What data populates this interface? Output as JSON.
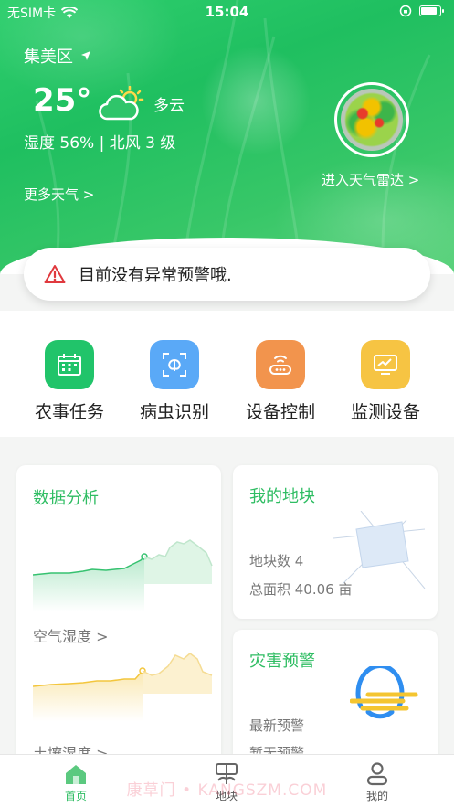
{
  "status_bar": {
    "carrier": "无SIM卡",
    "time": "15:04"
  },
  "weather": {
    "location": "集美区",
    "temperature": "25°",
    "condition": "多云",
    "humidity_wind": "湿度 56% | 北风 3 级",
    "more_link": "更多天气 >",
    "radar_link": "进入天气雷达 >"
  },
  "alert": {
    "message": "目前没有异常预警哦."
  },
  "quick_actions": [
    {
      "label": "农事任务",
      "icon": "calendar-icon",
      "color": "#21c46a"
    },
    {
      "label": "病虫识别",
      "icon": "bug-scan-icon",
      "color": "#5aa9f7"
    },
    {
      "label": "设备控制",
      "icon": "router-icon",
      "color": "#f2944d"
    },
    {
      "label": "监测设备",
      "icon": "monitor-chart-icon",
      "color": "#f6c443"
    }
  ],
  "data_analysis": {
    "title": "数据分析",
    "air_humidity_link": "空气湿度 >",
    "soil_humidity_link": "土壤湿度 >"
  },
  "my_plots": {
    "title": "我的地块",
    "count": "地块数 4",
    "area": "总面积 40.06 亩"
  },
  "disaster_warning": {
    "title": "灾害预警",
    "latest_label": "最新预警",
    "latest_value": "暂无预警"
  },
  "tab_bar": [
    {
      "label": "首页",
      "icon": "home-icon",
      "active": true
    },
    {
      "label": "地块",
      "icon": "plot-icon",
      "active": false
    },
    {
      "label": "我的",
      "icon": "user-icon",
      "active": false
    }
  ],
  "watermark": "康草门 • KANGSZM.COM",
  "colors": {
    "brand_green": "#2fbd63",
    "alert_red": "#e0393e"
  }
}
